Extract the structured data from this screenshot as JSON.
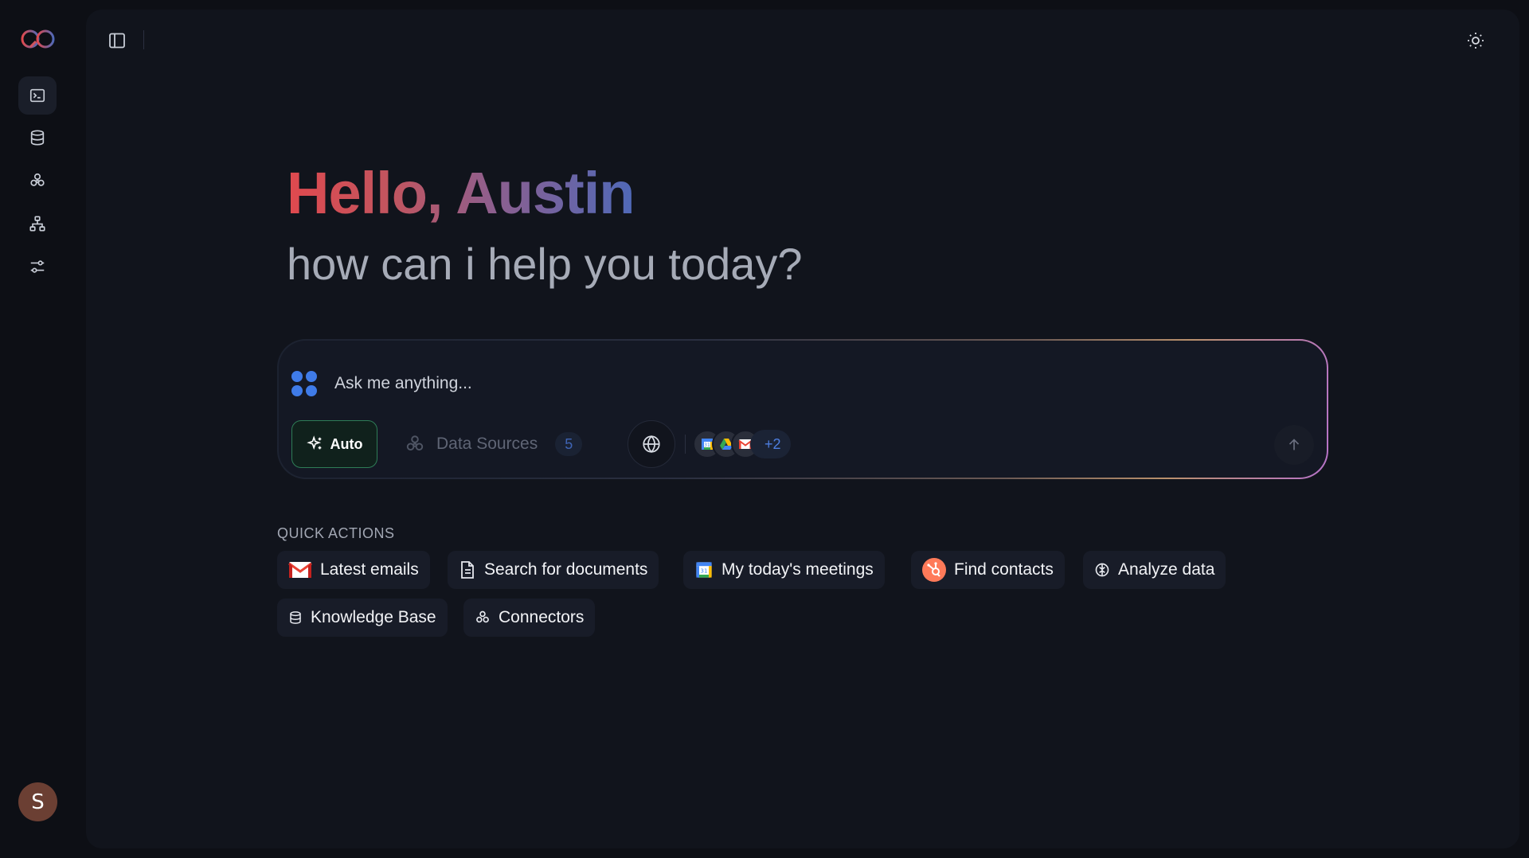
{
  "sidebar": {
    "logo": "infinity-logo",
    "items": [
      {
        "icon": "terminal-icon",
        "active": true
      },
      {
        "icon": "database-icon",
        "active": false
      },
      {
        "icon": "connectors-icon",
        "active": false
      },
      {
        "icon": "org-chart-icon",
        "active": false
      },
      {
        "icon": "sliders-icon",
        "active": false
      }
    ],
    "avatar_initial": "S"
  },
  "header": {
    "toggle_icon": "sidebar-toggle-icon",
    "theme_icon": "sun-icon"
  },
  "hero": {
    "greeting": "Hello, Austin",
    "subtitle": "how can i help you today?"
  },
  "chat": {
    "placeholder": "Ask me anything...",
    "mode_label": "Auto",
    "data_sources_label": "Data Sources",
    "data_sources_count": "5",
    "connected_sources": [
      "google-calendar-icon",
      "google-drive-icon",
      "gmail-icon"
    ],
    "more_sources": "+2"
  },
  "quick_actions": {
    "title": "QUICK ACTIONS",
    "items": [
      {
        "label": "Latest emails",
        "icon": "gmail-icon"
      },
      {
        "label": "Search for documents",
        "icon": "document-icon"
      },
      {
        "label": "My today's meetings",
        "icon": "google-calendar-icon"
      },
      {
        "label": "Find contacts",
        "icon": "hubspot-icon"
      },
      {
        "label": "Analyze data",
        "icon": "brain-icon"
      },
      {
        "label": "Knowledge Base",
        "icon": "database-icon"
      },
      {
        "label": "Connectors",
        "icon": "connectors-icon"
      }
    ]
  },
  "colors": {
    "background": "#0d0f15",
    "panel": "#11141c",
    "accent_blue": "#3f7be8",
    "greeting_start": "#e0494e",
    "greeting_end": "#4f69b8",
    "auto_border": "#2e7d57"
  }
}
